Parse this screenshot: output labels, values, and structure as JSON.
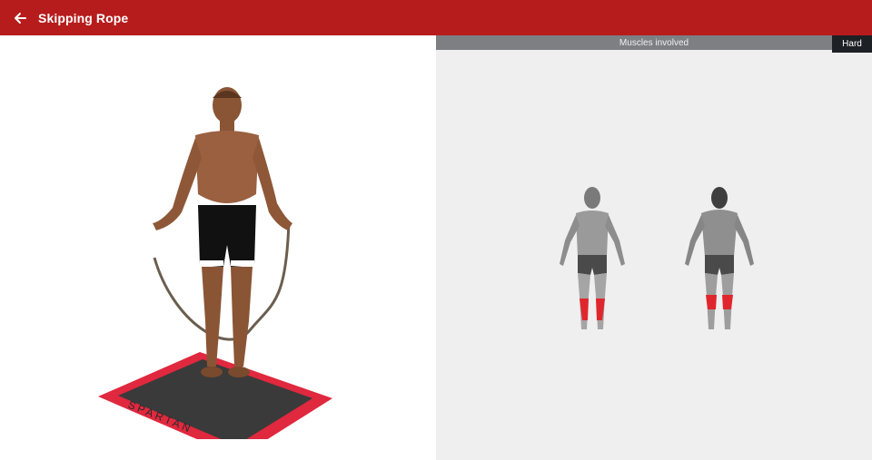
{
  "header": {
    "title": "Skipping Rope",
    "back_icon": "arrow-left-icon"
  },
  "exercise": {
    "mat_text": "SPARTAN"
  },
  "muscles": {
    "heading": "Muscles involved",
    "difficulty": "Hard",
    "highlight_color": "#e0262d",
    "highlighted": [
      "calves"
    ]
  },
  "colors": {
    "appbar": "#b71c1c",
    "panel_bg": "#efefef"
  }
}
